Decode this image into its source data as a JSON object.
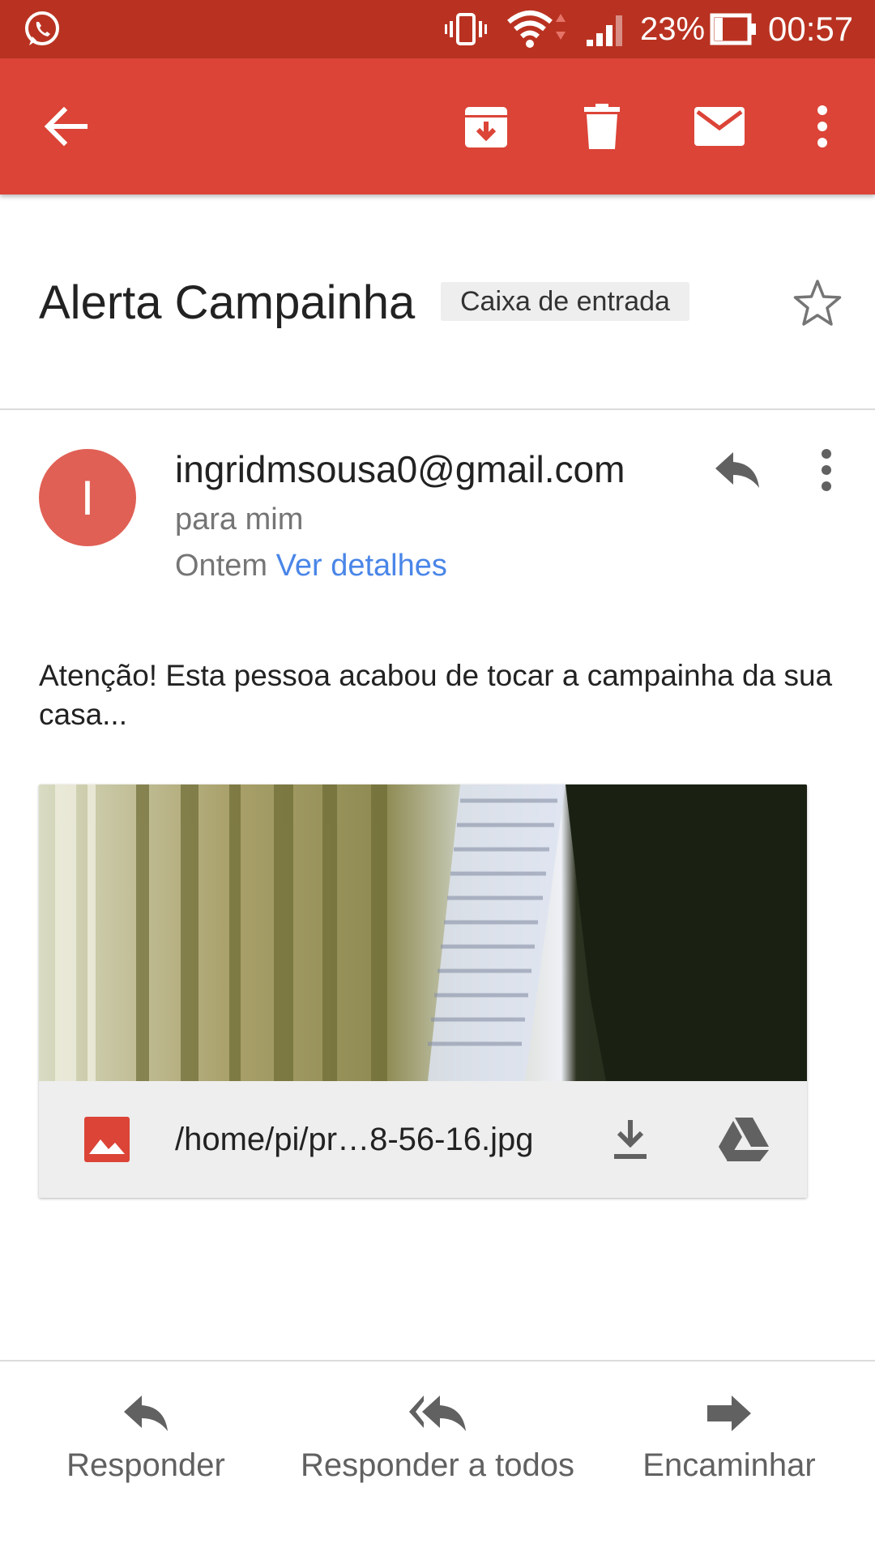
{
  "status_bar": {
    "battery_percent": "23%",
    "time": "00:57",
    "icons": [
      "whatsapp-icon",
      "vibrate-icon",
      "wifi-icon",
      "signal-icon",
      "battery-icon"
    ]
  },
  "app_bar": {
    "color": "#db4437",
    "actions": [
      "back-arrow-icon",
      "archive-icon",
      "delete-icon",
      "mark-unread-icon",
      "more-vert-icon"
    ]
  },
  "email": {
    "subject": "Alerta Campainha",
    "label": "Caixa de entrada",
    "avatar_letter": "I",
    "avatar_color": "#e06055",
    "sender": "ingridmsousa0@gmail.com",
    "recipient": "para mim",
    "date": "Ontem",
    "details_link": "Ver detalhes",
    "body": "Atenção! Esta pessoa acabou de tocar a campainha da sua casa..."
  },
  "attachment": {
    "filename": "/home/pi/pr…8-56-16.jpg",
    "icons": [
      "image-file-icon",
      "download-icon",
      "drive-icon"
    ]
  },
  "bottom_actions": {
    "reply": "Responder",
    "reply_all": "Responder a todos",
    "forward": "Encaminhar"
  }
}
